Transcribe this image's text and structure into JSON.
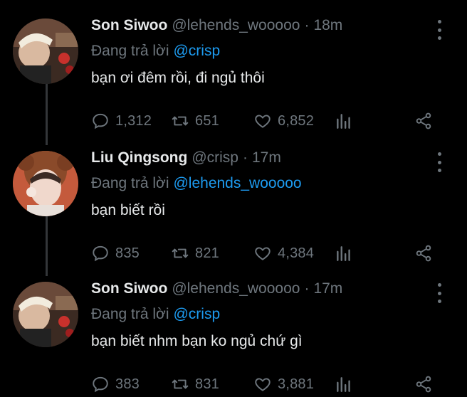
{
  "tweets": [
    {
      "name": "Son Siwoo",
      "handle": "@lehends_wooooo",
      "time": "18m",
      "reply_prefix": "Đang trả lời",
      "reply_to": "@crisp",
      "text": "bạn ơi đêm rồi, đi ngủ thôi",
      "replies": "1,312",
      "retweets": "651",
      "likes": "6,852"
    },
    {
      "name": "Liu Qingsong",
      "handle": "@crisp",
      "time": "17m",
      "reply_prefix": "Đang trả lời",
      "reply_to": "@lehends_wooooo",
      "text": "bạn biết rồi",
      "replies": "835",
      "retweets": "821",
      "likes": "4,384"
    },
    {
      "name": "Son Siwoo",
      "handle": "@lehends_wooooo",
      "time": "17m",
      "reply_prefix": "Đang trả lời",
      "reply_to": "@crisp",
      "text": "bạn biết nhm bạn ko ngủ chứ gì",
      "replies": "383",
      "retweets": "831",
      "likes": "3,881"
    }
  ],
  "icons": {
    "reply": "speech-bubble",
    "retweet": "retweet-arrows",
    "like": "heart",
    "analytics": "bar-chart",
    "share": "share-nodes",
    "more": "vertical-dots"
  },
  "colors": {
    "background": "#000000",
    "text": "#e7e9ea",
    "muted": "#6e767d",
    "mention": "#1d9bf0",
    "thread_line": "#333639"
  }
}
